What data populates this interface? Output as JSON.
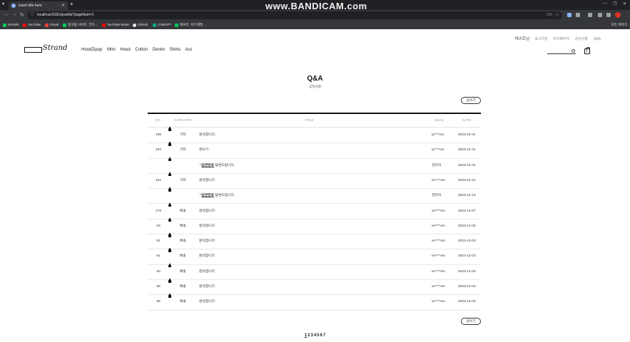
{
  "browser": {
    "tab_title": "insert title here",
    "url": "localhost:8181/qna/list?pageNum=1",
    "watermark": "www.BANDICAM.com",
    "bookmarks": [
      "NAVER",
      "YouTube",
      "Gmail",
      "정고림 사이즈, 굿즈...",
      "YouTube Music",
      "GitHub",
      "ChatGPT",
      "에브다. 자기개발 ..."
    ],
    "bookmarks_right": "모든 북마크",
    "omni_right": "Ctrl"
  },
  "header": {
    "top_links": [
      "테스트님",
      "로그아웃",
      "마이페이지",
      "공지사항",
      "Q&A"
    ],
    "logo_text": "Strand",
    "menu": [
      "HoodZipup",
      "Mtm",
      "Hood",
      "Cotton",
      "Denim",
      "Shirts",
      "Acc"
    ],
    "cart_count": "0"
  },
  "main": {
    "title": "Q&A",
    "subtitle": "공지사항",
    "write_label": "글쓰기",
    "columns": [
      "NO.",
      "CATEGORY",
      "TITLE",
      "EMAIL",
      "DATE"
    ],
    "rows": [
      {
        "no": "195",
        "cat": "기타",
        "title": "문의합니다.",
        "email": "iy****om",
        "date": "2023-12-31"
      },
      {
        "no": "194",
        "cat": "기타",
        "title": "글쓰기",
        "email": "iy****om",
        "date": "2023-12-31"
      },
      {
        "no": "",
        "cat": "",
        "reply": "답변완료",
        "title": "답변드립니다.",
        "email": "관리자",
        "date": "2023-12-31"
      },
      {
        "no": "191",
        "cat": "기타",
        "title": "문의합니다",
        "email": "vs****om",
        "date": "2023-12-12"
      },
      {
        "no": "",
        "cat": "",
        "reply": "답변완료",
        "title": "답변드립니다.",
        "email": "관리자",
        "date": "2023-12-13"
      },
      {
        "no": "176",
        "cat": "배송",
        "title": "문의합니다",
        "email": "vs****om",
        "date": "2023-12-07"
      },
      {
        "no": "63",
        "cat": "배송",
        "title": "문의합니다",
        "email": "vs****om",
        "date": "2023-12-03"
      },
      {
        "no": "62",
        "cat": "배송",
        "title": "문의합니다",
        "email": "vs****om",
        "date": "2023-12-03"
      },
      {
        "no": "61",
        "cat": "배송",
        "title": "문의합니다",
        "email": "vs****om",
        "date": "2023-12-03"
      },
      {
        "no": "60",
        "cat": "배송",
        "title": "문의합니다",
        "email": "vs****om",
        "date": "2023-12-03"
      },
      {
        "no": "59",
        "cat": "배송",
        "title": "문의합니다",
        "email": "vs****om",
        "date": "2023-12-03"
      },
      {
        "no": "58",
        "cat": "배송",
        "title": "문의합니다",
        "email": "vs****om",
        "date": "2023-12-03"
      }
    ],
    "reply_prefix": "└",
    "pages": [
      "1",
      "2",
      "3",
      "4",
      "5",
      "6",
      "7"
    ],
    "current_page": "1"
  }
}
